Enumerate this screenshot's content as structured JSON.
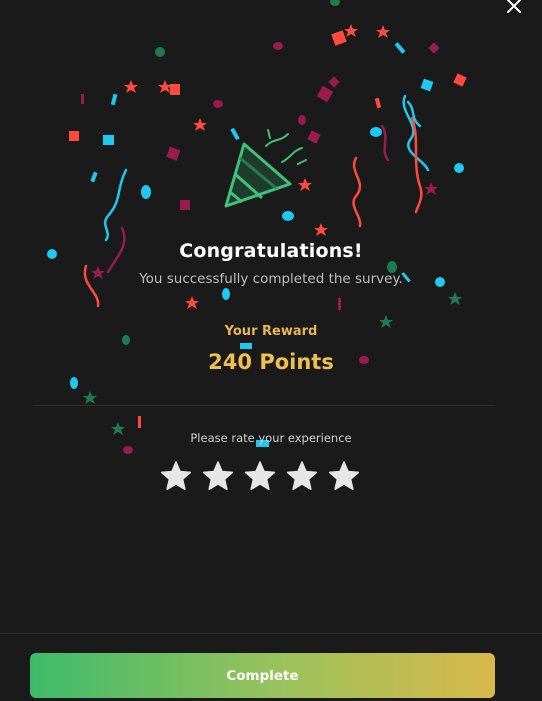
{
  "dialog": {
    "title": "Congratulations!",
    "subtitle": "You successfully completed the survey.",
    "reward_label": "Your Reward",
    "reward_value": "240 Points",
    "rating_prompt": "Please rate your experience",
    "rating": {
      "max": 5,
      "selected": 0
    },
    "complete_label": "Complete"
  },
  "icons": {
    "close": "close-icon",
    "celebration": "party-popper-icon",
    "star": "star-icon"
  },
  "colors": {
    "background": "#1a1a1a",
    "title": "#ffffff",
    "subtitle": "#bdbdbd",
    "reward": "#f0c04f",
    "star": "#e6e6e6",
    "button_gradient_start": "#3dbb6a",
    "button_gradient_end": "#d9b84a",
    "confetti": [
      "#ff4a3d",
      "#1ec8f0",
      "#9b1b4d",
      "#1f7a52"
    ]
  }
}
